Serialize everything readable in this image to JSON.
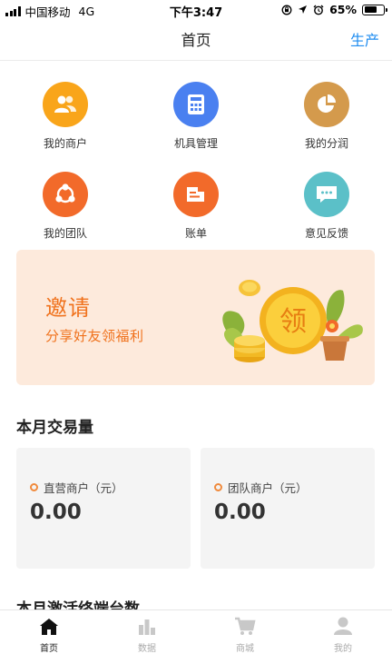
{
  "status_bar": {
    "carrier": "中国移动",
    "network": "4G",
    "time": "下午3:47",
    "battery": "65%",
    "battery_level": 0.65
  },
  "nav": {
    "title": "首页",
    "right_action": "生产"
  },
  "grid": [
    {
      "label": "我的商户",
      "icon": "merchants-icon",
      "color": "#f9a51a"
    },
    {
      "label": "机具管理",
      "icon": "calculator-icon",
      "color": "#4a80f0"
    },
    {
      "label": "我的分润",
      "icon": "pie-chart-icon",
      "color": "#d49a4c"
    },
    {
      "label": "我的团队",
      "icon": "team-icon",
      "color": "#f26a2a"
    },
    {
      "label": "账单",
      "icon": "bill-icon",
      "color": "#f26a2a"
    },
    {
      "label": "意见反馈",
      "icon": "chat-icon",
      "color": "#5bc0c8"
    }
  ],
  "banner": {
    "title": "邀请",
    "subtitle": "分享好友领福利",
    "coin_text": "领"
  },
  "monthly_volume": {
    "title": "本月交易量",
    "cards": [
      {
        "label": "直营商户（元）",
        "value": "0.00"
      },
      {
        "label": "团队商户（元）",
        "value": "0.00"
      }
    ]
  },
  "activation": {
    "title": "本月激活终端台数"
  },
  "tabbar": [
    {
      "label": "首页",
      "icon": "home-icon",
      "active": true
    },
    {
      "label": "数据",
      "icon": "bar-chart-icon",
      "active": false
    },
    {
      "label": "商城",
      "icon": "cart-icon",
      "active": false
    },
    {
      "label": "我的",
      "icon": "user-icon",
      "active": false
    }
  ]
}
